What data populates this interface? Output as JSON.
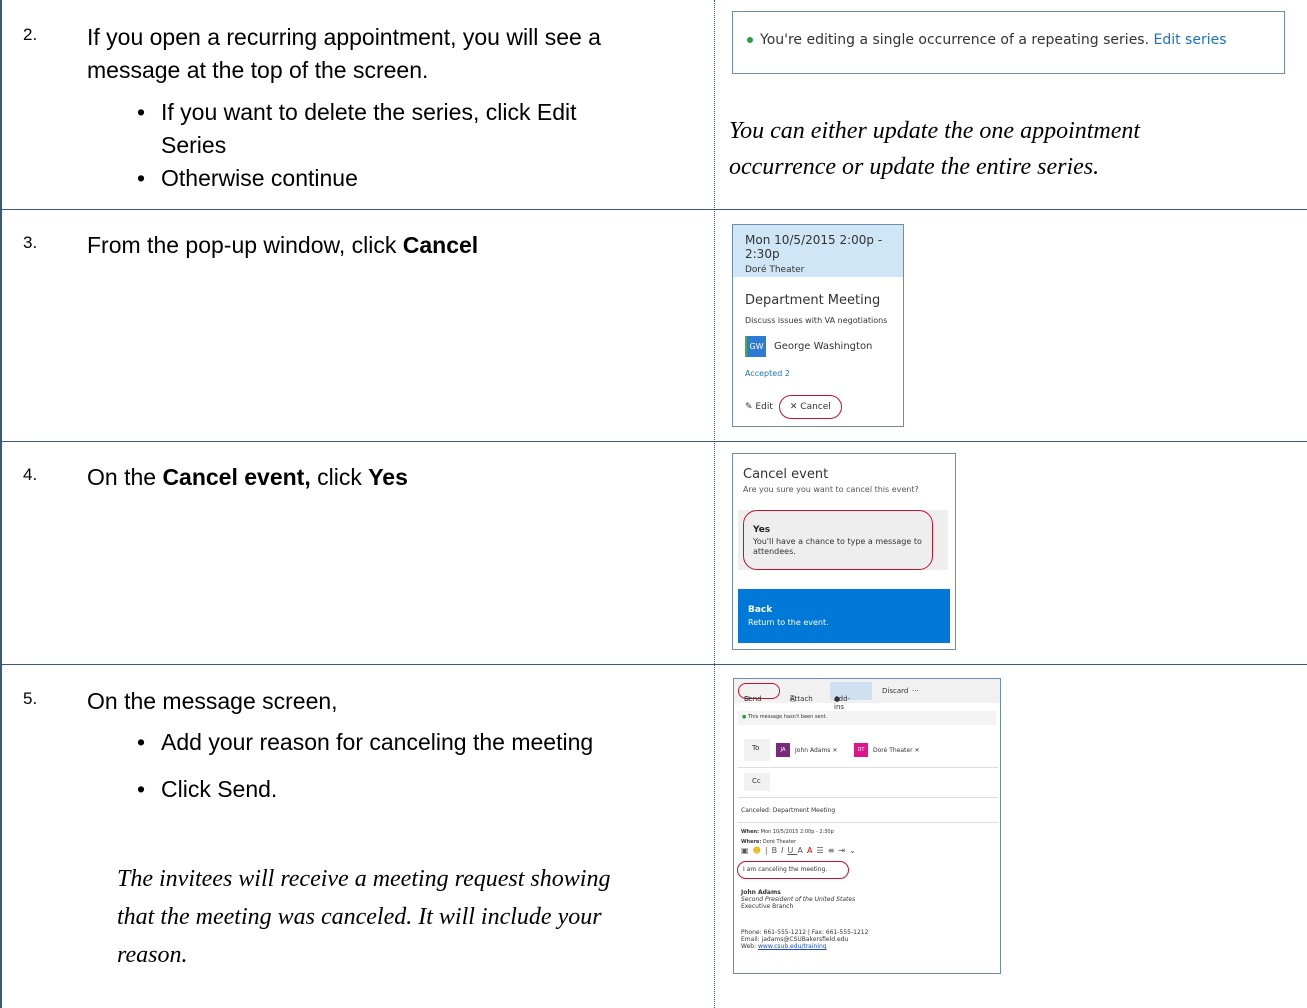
{
  "steps": [
    {
      "number": "2.",
      "line1": "If you open a recurring appointment, you will see a",
      "line2": "message at the top of the screen.",
      "bullets": [
        "If you want to delete the series, click Edit",
        "Series",
        "Otherwise continue"
      ],
      "note_line1": "You can either update the one appointment",
      "note_line2": "occurrence or update the entire series."
    },
    {
      "number": "3.",
      "text_pre": "From the pop-up window, click ",
      "text_bold": "Cancel"
    },
    {
      "number": "4.",
      "text_pre": "On the ",
      "text_bold1": "Cancel event,",
      "text_mid": " click ",
      "text_bold2": "Yes"
    },
    {
      "number": "5.",
      "line1": "On the message screen,",
      "bullets": [
        "Add your reason for canceling the meeting",
        "Click Send."
      ],
      "note_lines": [
        "The invitees will receive a meeting request showing",
        "that the meeting was canceled. It will include your",
        "reason."
      ]
    }
  ],
  "shot1": {
    "message": "You're editing a single occurrence of a repeating series.",
    "link": "Edit series",
    "status_color": "#2e9e3a"
  },
  "shot2": {
    "time": "Mon 10/5/2015 2:00p - 2:30p",
    "location": "Doré Theater",
    "title": "Department Meeting",
    "description": "Discuss issues with VA negotiations",
    "avatar_initials": "GW",
    "person": "George Washington",
    "accepted": "Accepted 2",
    "edit": "Edit",
    "cancel": "Cancel",
    "header_color": "#cfe6f7"
  },
  "shot3": {
    "title": "Cancel event",
    "question": "Are you sure you want to cancel this event?",
    "yes_title": "Yes",
    "yes_sub1": "You'll have a chance to type a message to",
    "yes_sub2": "attendees.",
    "back_title": "Back",
    "back_sub": "Return to the event.",
    "back_color": "#0078d7"
  },
  "shot4": {
    "send": "Send",
    "attach": "Attach",
    "addins": "Add-ins",
    "discard": "Discard",
    "more": "···",
    "not_sent": "This message hasn't been sent.",
    "to": "To",
    "recipient1_initials": "JA",
    "recipient1": "John Adams",
    "recipient2_initials": "DT",
    "recipient2": "Doré Theater",
    "cc": "Cc",
    "subject": "Canceled: Department Meeting",
    "when_label": "When:",
    "when_value": "Mon 10/5/2015 2:00p - 2:30p",
    "where_label": "Where:",
    "where_value": "Doré Theater",
    "reason": "I am canceling the meeting.",
    "sig_name": "John Adams",
    "sig_title": "Second President of the United States",
    "sig_branch": "Executive Branch",
    "phone": "Phone: 661-555-1212 | Fax: 661-555-1212",
    "email": "Email: jadams@CSUBakersfield.edu",
    "web_label": "Web: ",
    "web_link": "www.csub.edu/training"
  }
}
